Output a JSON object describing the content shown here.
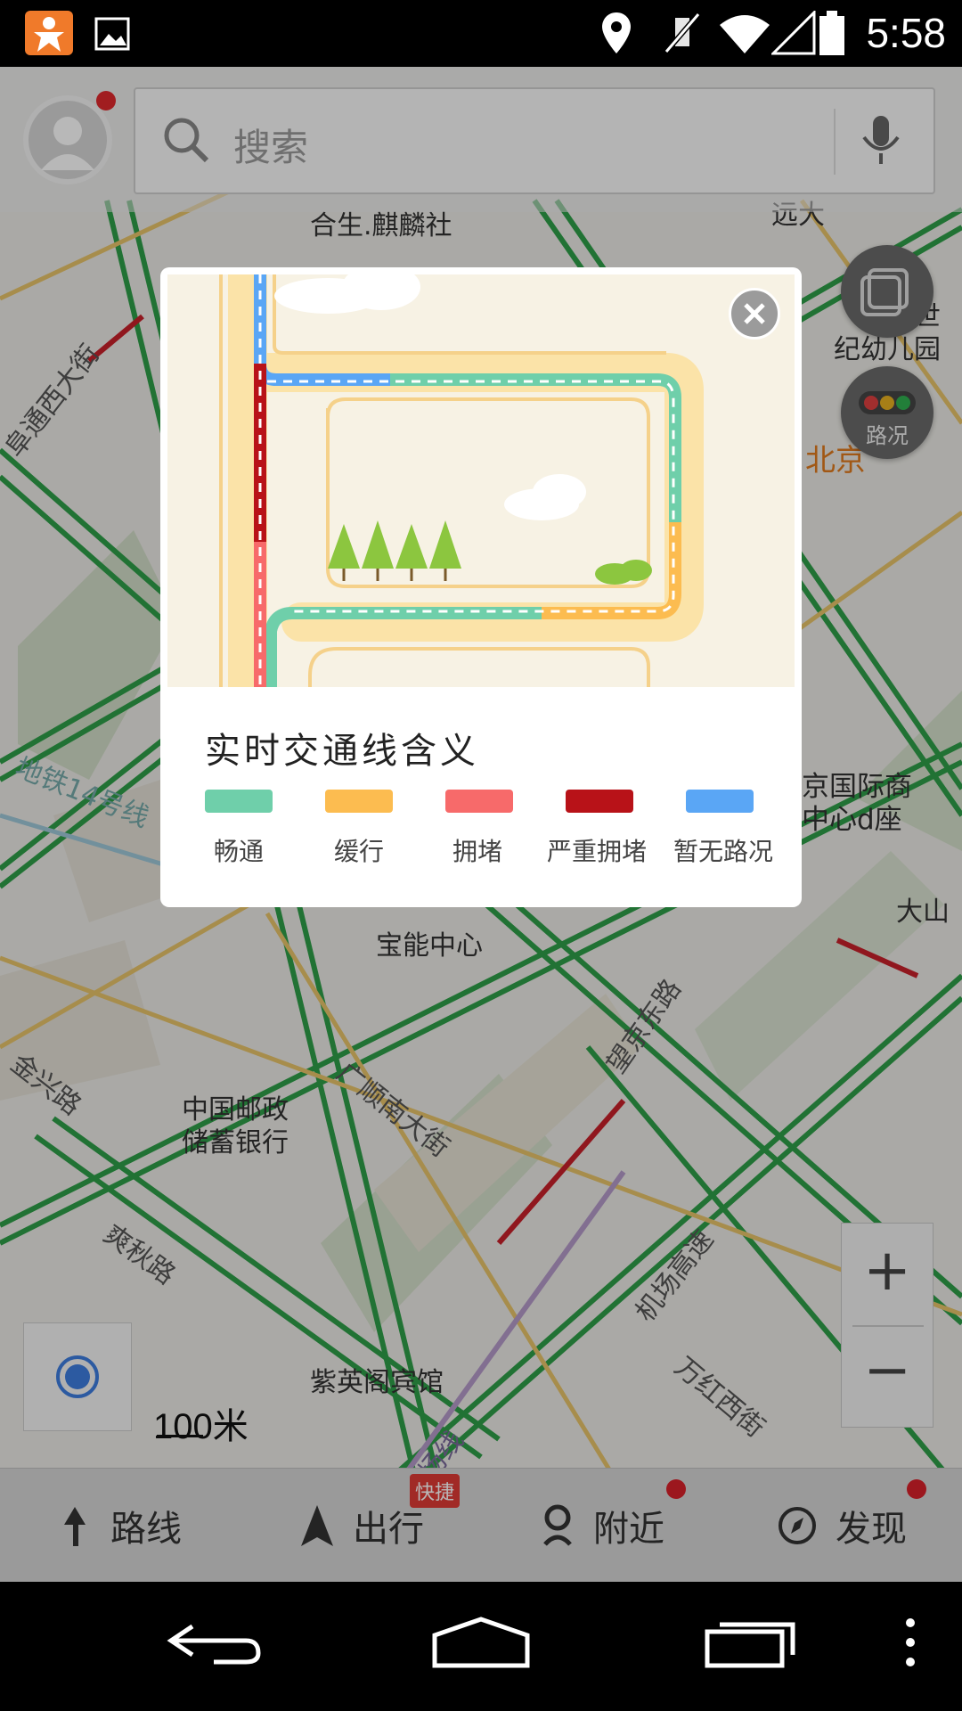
{
  "status_bar": {
    "time": "5:58"
  },
  "search": {
    "placeholder": "搜索"
  },
  "map": {
    "pois": [
      "合生.麒麟社",
      "宝能中心",
      "中国邮政\n储蓄银行",
      "紫英阁宾馆",
      "世\n纪幼儿园",
      "北京",
      "京国际商\n中心d座",
      "大山",
      "远大"
    ],
    "roads": [
      "阜通西大街",
      "地铁14号线",
      "金兴路",
      "广顺南大街",
      "望京东路",
      "爽秋路",
      "机场高速",
      "万红西街",
      "机场线"
    ],
    "traffic_button_label": "路况",
    "scale_label": "100米",
    "zoom_in": "+",
    "zoom_out": "−"
  },
  "dialog": {
    "title": "实时交通线含义",
    "legend": [
      {
        "label": "畅通",
        "color": "#6fcfaa"
      },
      {
        "label": "缓行",
        "color": "#fcbc50"
      },
      {
        "label": "拥堵",
        "color": "#f76a6a"
      },
      {
        "label": "严重拥堵",
        "color": "#b81218"
      },
      {
        "label": "暂无路况",
        "color": "#5aa6f5"
      }
    ]
  },
  "bottom_nav": {
    "items": [
      {
        "label": "路线"
      },
      {
        "label": "出行",
        "badge": "快捷"
      },
      {
        "label": "附近"
      },
      {
        "label": "发现"
      }
    ]
  },
  "colors": {
    "accent_red": "#d8202a",
    "road_green": "#2f9e48",
    "road_yellow": "#e8c46a"
  }
}
